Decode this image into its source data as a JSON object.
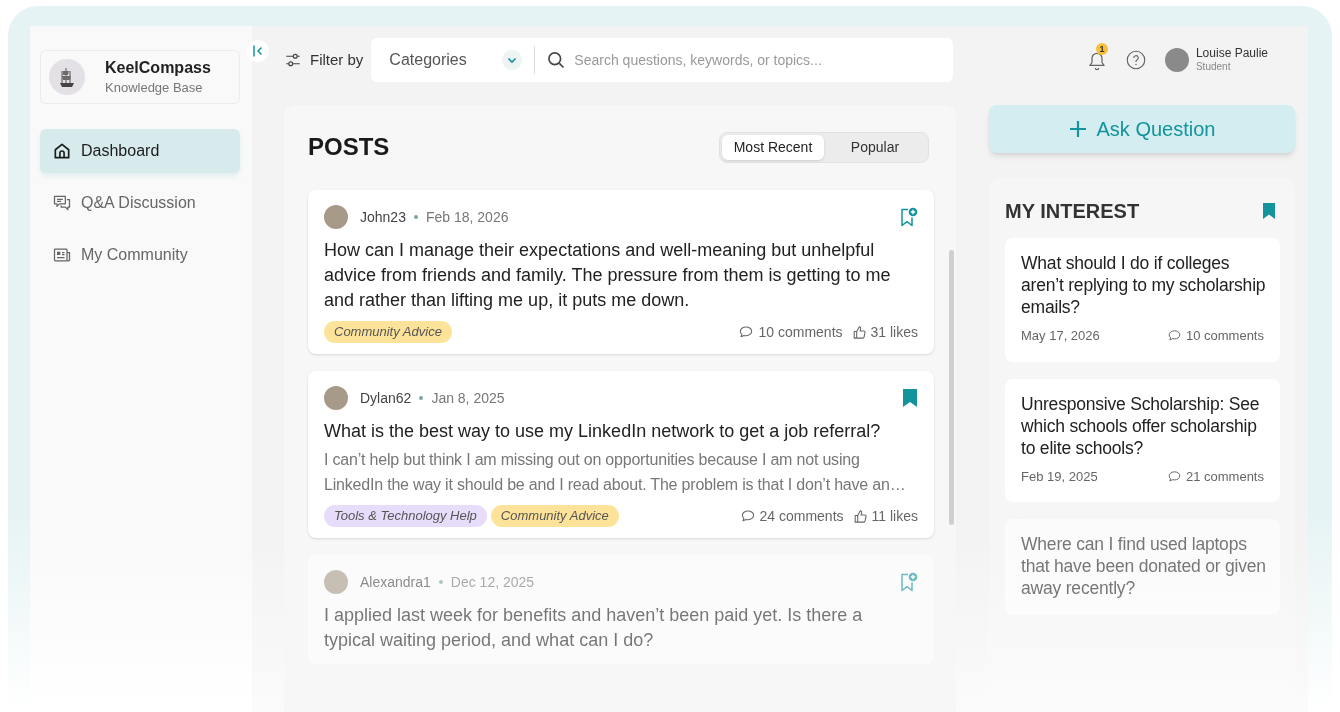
{
  "sidebar": {
    "brand": {
      "name": "KeelCompass",
      "subtitle": "Knowledge Base"
    },
    "items": [
      {
        "label": "Dashboard",
        "selected": true
      },
      {
        "label": "Q&A Discussion",
        "selected": false
      },
      {
        "label": "My Community",
        "selected": false
      }
    ]
  },
  "toolbar": {
    "filter_label": "Filter by",
    "category_select": {
      "value": "Categories"
    },
    "search": {
      "placeholder": "Search questions, keywords, or topics..."
    }
  },
  "user": {
    "notification_count": "1",
    "name": "Louise Paulie",
    "role": "Student"
  },
  "posts": {
    "title": "POSTS",
    "tabs": [
      {
        "label": "Most Recent",
        "selected": true
      },
      {
        "label": "Popular",
        "selected": false
      }
    ],
    "items": [
      {
        "author": "John23",
        "date": "Feb 18, 2026",
        "title": "How can I manage their expectations and well-meaning but unhelpful advice from friends and family. The pressure from them is getting to me and rather than lifting me up, it puts me down.",
        "tags": [
          {
            "label": "Community Advice",
            "color": "#fde39a"
          }
        ],
        "comments": "10 comments",
        "likes": "31 likes",
        "bookmarked": false,
        "faded": false
      },
      {
        "author": "Dylan62",
        "date": "Jan 8, 2025",
        "title": "What is the best way to use my LinkedIn network to get a job referral?",
        "excerpt": "I can’t help but think I am missing out on opportunities because I am not using LinkedIn the way it should be and I read about. The problem is that I don’t have an…",
        "tags": [
          {
            "label": "Tools & Technology Help",
            "color": "#e8dcfb"
          },
          {
            "label": "Community Advice",
            "color": "#fde39a"
          }
        ],
        "comments": "24 comments",
        "likes": "11 likes",
        "bookmarked": true,
        "faded": false
      },
      {
        "author": "Alexandra1",
        "date": "Dec 12, 2025",
        "title": "I applied last week for benefits and haven’t been paid yet. Is there a typical waiting period, and what can I do?",
        "bookmarked": false,
        "faded": true
      }
    ]
  },
  "ask_button": {
    "label": "Ask Question"
  },
  "interest": {
    "title": "MY INTEREST",
    "items": [
      {
        "title": "What should I do if colleges aren’t replying to my scholarship emails?",
        "date": "May 17, 2026",
        "comments": "10 comments",
        "faded": false
      },
      {
        "title": "Unresponsive Scholarship: See which schools offer scholarship to elite schools?",
        "date": "Feb 19, 2025",
        "comments": "21 comments",
        "faded": false
      },
      {
        "title": "Where can I find used laptops that have been donated or given away recently?",
        "faded": true
      }
    ]
  }
}
